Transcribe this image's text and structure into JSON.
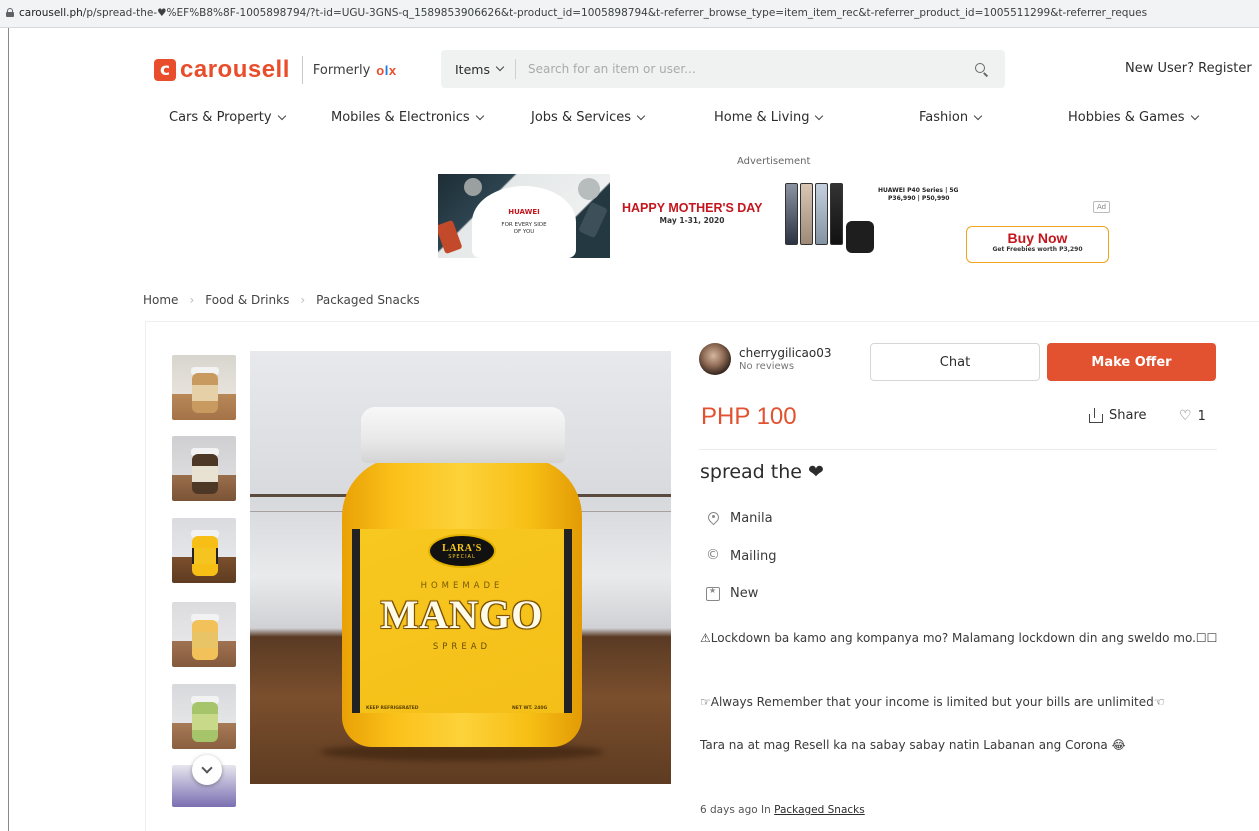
{
  "browser": {
    "url_domain": "carousell.ph",
    "url_path": "/p/spread-the-♥%EF%B8%8F-1005898794/?t-id=UGU-3GNS-q_1589853906626&t-product_id=1005898794&t-referrer_browse_type=item_item_rec&t-referrer_product_id=1005511299&t-referrer_reques"
  },
  "header": {
    "logo_mark": "c",
    "logo_text": "carousell",
    "formerly_label": "Formerly",
    "olx_o": "o",
    "olx_l": "l",
    "olx_x": "x",
    "search_category": "Items",
    "search_placeholder": "Search for an item or user...",
    "register_label": "New User? Register"
  },
  "categories": [
    "Cars & Property",
    "Mobiles & Electronics",
    "Jobs & Services",
    "Home & Living",
    "Fashion",
    "Hobbies & Games"
  ],
  "ad": {
    "label": "Advertisement",
    "brand": "HUAWEI",
    "tagline": "FOR EVERY SIDE OF YOU",
    "headline": "HAPPY MOTHER'S DAY",
    "dates": "May 1-31, 2020",
    "product": "HUAWEI P40 Series | 5G",
    "prices": "P36,990 | P50,990",
    "badge": "Ad",
    "cta_main": "Buy Now",
    "cta_sub": "Get Freebies worth P3,290"
  },
  "breadcrumb": [
    "Home",
    "Food & Drinks",
    "Packaged Snacks"
  ],
  "listing": {
    "seller_name": "cherrygilicao03",
    "seller_rating": "No reviews",
    "chat_label": "Chat",
    "offer_label": "Make Offer",
    "price": "PHP 100",
    "share_label": "Share",
    "likes": "1",
    "title": "spread the ❤",
    "location": "Manila",
    "delivery": "Mailing",
    "condition": "New",
    "description": [
      "⚠Lockdown ba kamo ang kompanya mo? Malamang lockdown din ang sweldo mo.☐☐",
      "☞Always Remember that your income is limited but your bills are unlimited☜",
      "Tara na at mag Resell ka na sabay sabay natin Labanan ang Corona 😂"
    ],
    "posted_prefix": "6 days ago In",
    "posted_category": "Packaged Snacks"
  },
  "photo": {
    "logo_main": "LARA'S",
    "logo_sub": "SPECIAL",
    "homemade": "HOMEMADE",
    "product_name": "MANGO",
    "spread": "SPREAD",
    "storage": "KEEP REFRIGERATED",
    "weight": "NET WT. 240G"
  },
  "colors": {
    "brand": "#e84e2c",
    "price": "#e25130",
    "offer_button": "#e25130"
  }
}
